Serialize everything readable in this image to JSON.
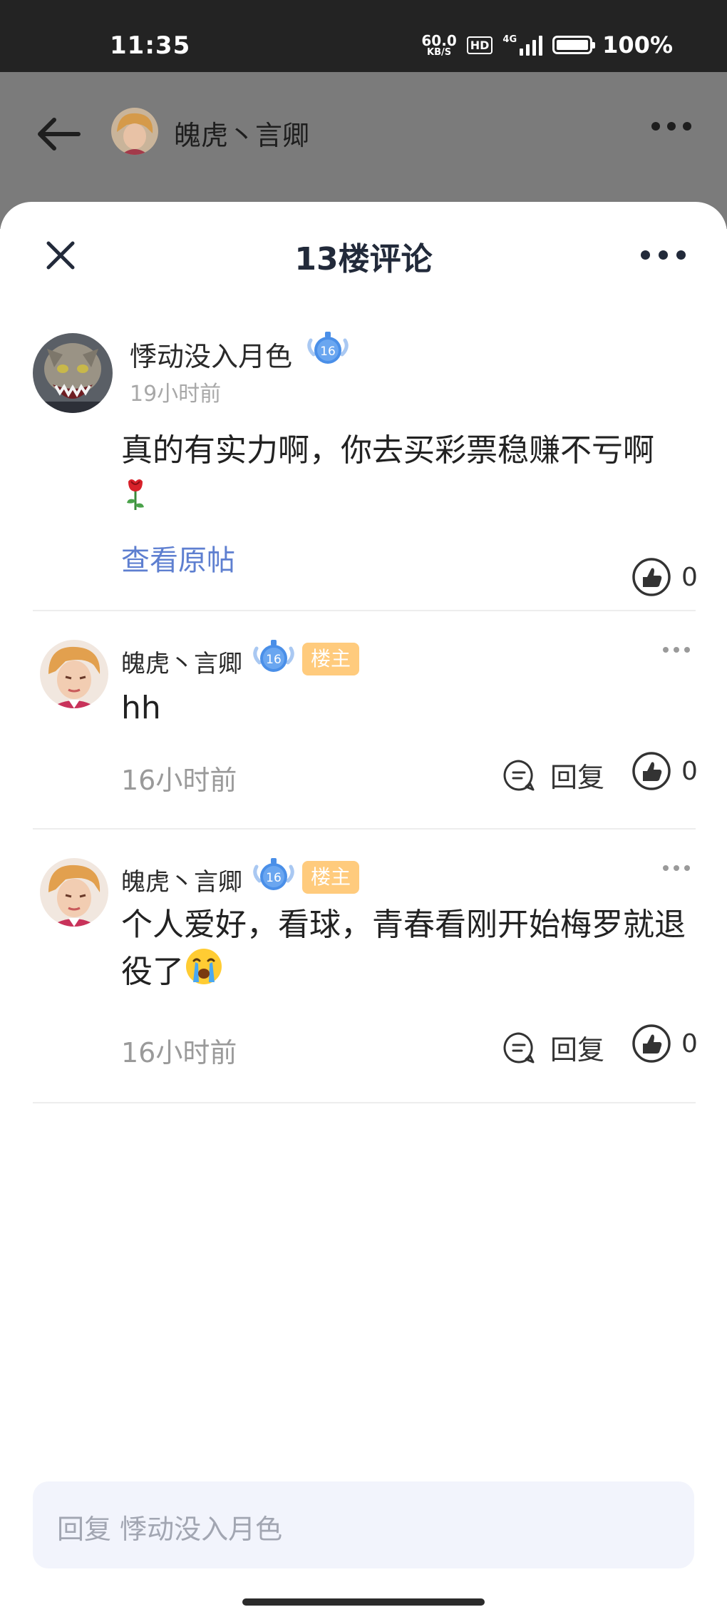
{
  "status_bar": {
    "time": "11:35",
    "net_speed_value": "60.0",
    "net_speed_unit": "KB/S",
    "hd_label": "HD",
    "network_label": "4G",
    "battery_percent": "100%"
  },
  "header": {
    "user_name": "魄虎丶言卿"
  },
  "sheet": {
    "title": "13楼评论"
  },
  "main_comment": {
    "user_name": "悸动没入月色",
    "level": "16",
    "time": "19小时前",
    "text": "真的有实力啊，你去买彩票稳赚不亏啊",
    "emoji": "rose",
    "view_original_label": "查看原帖",
    "like_count": "0"
  },
  "replies": [
    {
      "user_name": "魄虎丶言卿",
      "level": "16",
      "owner_badge": "楼主",
      "text": "hh",
      "time": "16小时前",
      "reply_label": "回复",
      "like_count": "0"
    },
    {
      "user_name": "魄虎丶言卿",
      "level": "16",
      "owner_badge": "楼主",
      "text": "个人爱好，看球，青春看刚开始梅罗就退役了",
      "emoji": "crying-face",
      "time": "16小时前",
      "reply_label": "回复",
      "like_count": "0"
    }
  ],
  "reply_input": {
    "placeholder": "回复 悸动没入月色"
  },
  "colors": {
    "status_bar_bg": "#232323",
    "dim_overlay": "#7b7b7b",
    "link_blue": "#5e7fd0",
    "owner_badge_bg": "#ffcb7d",
    "level_badge_blue": "#4a8fe8",
    "input_bg": "#f2f4fc"
  }
}
